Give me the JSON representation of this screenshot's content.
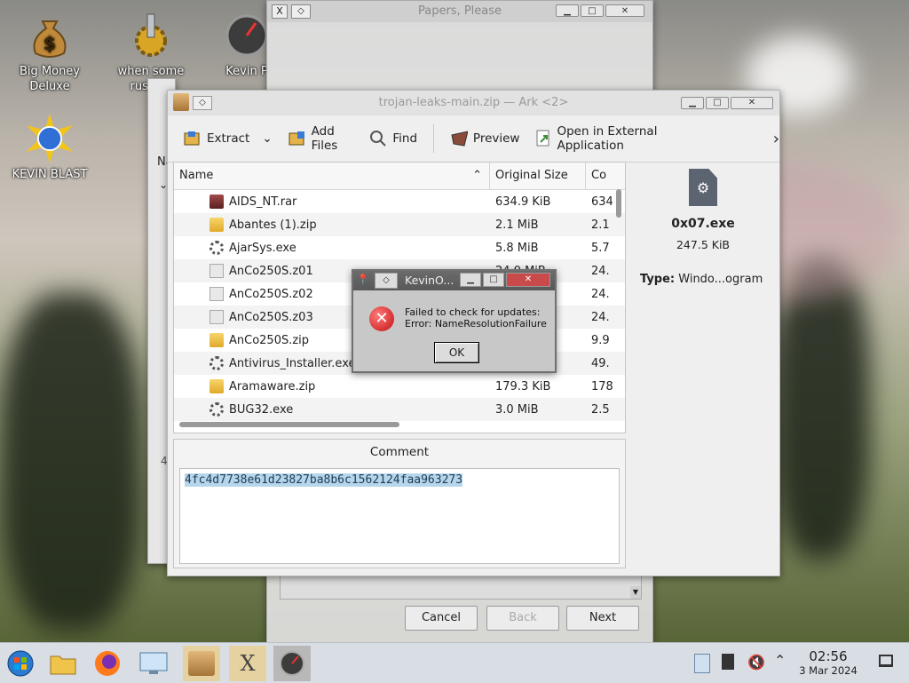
{
  "desktop": {
    "icons": [
      {
        "label": "Big Money Deluxe"
      },
      {
        "label": "when some russian"
      },
      {
        "label": "Kevin P"
      },
      {
        "label": "KEVIN BLAST"
      }
    ]
  },
  "wizard": {
    "title": "Papers, Please",
    "buttons": {
      "cancel": "Cancel",
      "back": "Back",
      "next": "Next"
    }
  },
  "ark": {
    "title": "trojan-leaks-main.zip — Ark <2>",
    "toolbar": {
      "extract": "Extract",
      "add_files": "Add Files",
      "find": "Find",
      "preview": "Preview",
      "open_external": "Open in External Application"
    },
    "columns": {
      "name": "Name",
      "original_size": "Original Size",
      "compressed": "Co"
    },
    "files": [
      {
        "name": "AIDS_NT.rar",
        "size": "634.9 KiB",
        "comp": "634",
        "icon": "rar"
      },
      {
        "name": "Abantes (1).zip",
        "size": "2.1 MiB",
        "comp": "2.1",
        "icon": "zip"
      },
      {
        "name": "AjarSys.exe",
        "size": "5.8 MiB",
        "comp": "5.7",
        "icon": "exe"
      },
      {
        "name": "AnCo250S.z01",
        "size": "24.0 MiB",
        "comp": "24.",
        "icon": "gen"
      },
      {
        "name": "AnCo250S.z02",
        "size": "24.0 MiB",
        "comp": "24.",
        "icon": "gen"
      },
      {
        "name": "AnCo250S.z03",
        "size": "",
        "comp": "24.",
        "icon": "gen"
      },
      {
        "name": "AnCo250S.zip",
        "size": "",
        "comp": "9.9",
        "icon": "zip"
      },
      {
        "name": "Antivirus_Installer.exe",
        "size": "",
        "comp": "49.",
        "icon": "exe"
      },
      {
        "name": "Aramaware.zip",
        "size": "179.3 KiB",
        "comp": "178",
        "icon": "zip"
      },
      {
        "name": "BUG32.exe",
        "size": "3.0 MiB",
        "comp": "2.5",
        "icon": "exe"
      }
    ],
    "details": {
      "filename": "0x07.exe",
      "size": "247.5 KiB",
      "type_label": "Type:",
      "type_value": "Windo...ogram"
    },
    "comment": {
      "label": "Comment",
      "text": "4fc4d7738e61d23827ba8b6c1562124faa963273"
    }
  },
  "left_window": {
    "col_label": "Na",
    "digit": "4"
  },
  "dialog": {
    "title": "KevinO...",
    "line1": "Failed to check for updates:",
    "line2": "Error: NameResolutionFailure",
    "ok": "OK"
  },
  "taskbar": {
    "time": "02:56",
    "date": "3 Mar 2024"
  }
}
